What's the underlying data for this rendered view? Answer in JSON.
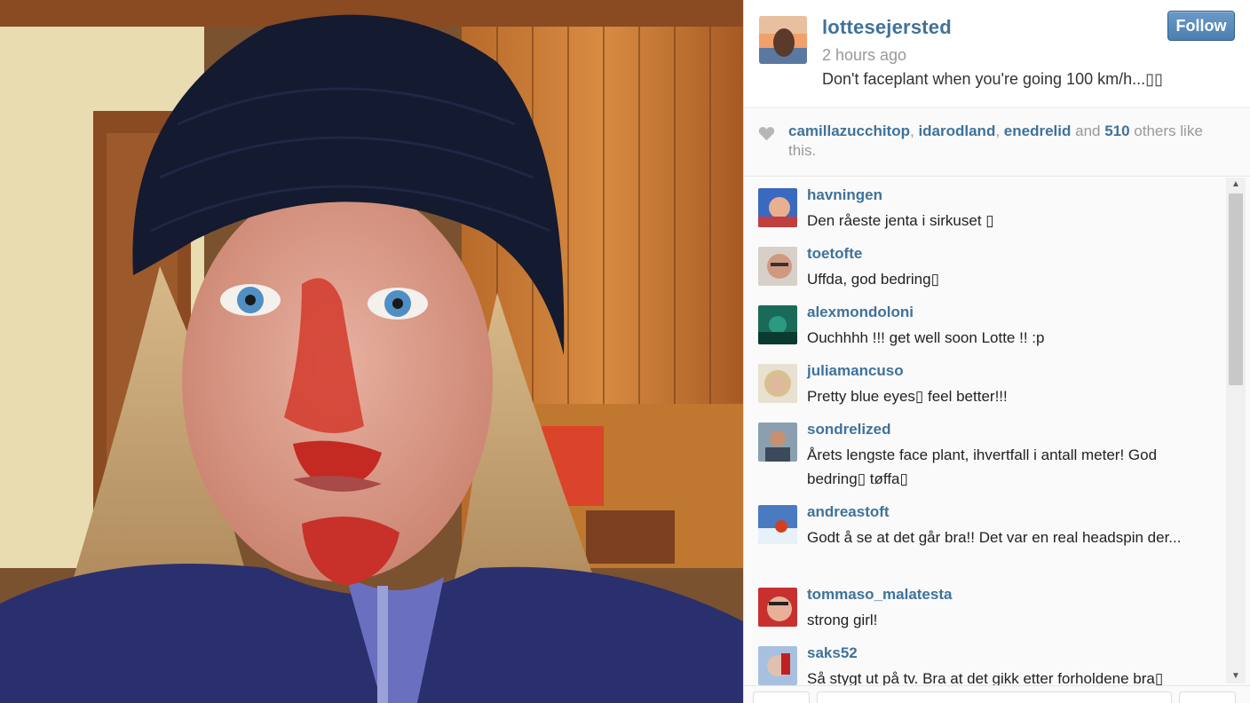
{
  "post": {
    "username": "lottesejersted",
    "time": "2 hours ago",
    "caption": "Don't faceplant when you're going 100 km/h...▯▯",
    "follow_label": "Follow"
  },
  "likes": {
    "users": [
      "camillazucchitop",
      "idarodland",
      "enedrelid"
    ],
    "sep1": ", ",
    "sep2": ", ",
    "and_text": " and ",
    "count": "510",
    "rest": " others like this."
  },
  "comments": [
    {
      "user": "havningen",
      "text": "Den råeste jenta i sirkuset ▯"
    },
    {
      "user": "toetofte",
      "text": "Uffda, god bedring▯"
    },
    {
      "user": "alexmondoloni",
      "text": "Ouchhhh !!! get well soon Lotte !! :p"
    },
    {
      "user": "juliamancuso",
      "text": "Pretty blue eyes▯ feel better!!!"
    },
    {
      "user": "sondrelized",
      "text": "Årets lengste face plant, ihvertfall i antall meter! God bedring▯ tøffa▯"
    },
    {
      "user": "andreastoft",
      "text": "Godt å se at det går bra!! Det var en real headspin der..."
    },
    {
      "user": "tommaso_malatesta",
      "text": "strong girl!"
    },
    {
      "user": "saks52",
      "text": "Så stygt ut på tv. Bra at det gikk etter forholdene bra▯"
    }
  ],
  "colors": {
    "link": "#3f729b",
    "follow_button": "#4c7fb0",
    "muted": "#999999"
  },
  "icons": {
    "like": "heart-icon",
    "scroll_up": "arrow-up-icon",
    "scroll_down": "arrow-down-icon"
  }
}
